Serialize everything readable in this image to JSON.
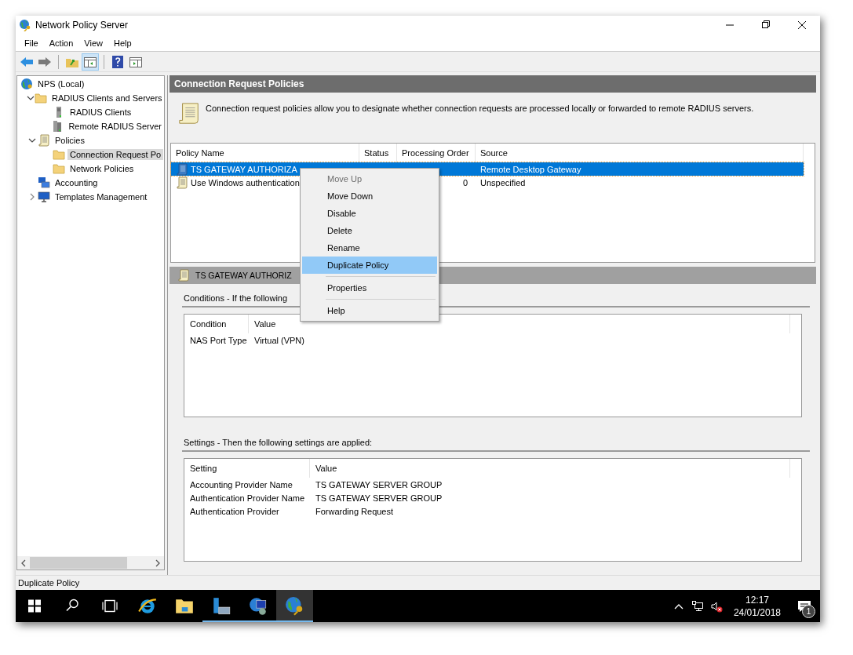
{
  "window": {
    "title": "Network Policy Server"
  },
  "menu": [
    "File",
    "Action",
    "View",
    "Help"
  ],
  "tree": [
    {
      "label": "NPS (Local)",
      "kind": "globe",
      "selected": false,
      "children": [
        {
          "label": "RADIUS Clients and Servers",
          "kind": "folder",
          "expanded": true,
          "selected": false,
          "children": [
            {
              "label": "RADIUS Clients",
              "kind": "server",
              "selected": false
            },
            {
              "label": "Remote RADIUS Server",
              "kind": "servers",
              "selected": false
            }
          ]
        },
        {
          "label": "Policies",
          "kind": "scroll",
          "expanded": true,
          "selected": false,
          "children": [
            {
              "label": "Connection Request Po",
              "kind": "folder",
              "selected": true
            },
            {
              "label": "Network Policies",
              "kind": "folder",
              "selected": false
            }
          ]
        },
        {
          "label": "Accounting",
          "kind": "computers",
          "selected": false
        },
        {
          "label": "Templates Management",
          "kind": "monitor",
          "expanded": false,
          "selected": false
        }
      ]
    }
  ],
  "pane": {
    "title": "Connection Request Policies",
    "description": "Connection request policies allow you to designate whether connection requests are processed locally or forwarded to remote RADIUS servers."
  },
  "policies": {
    "columns": [
      "Policy Name",
      "Status",
      "Processing Order",
      "Source"
    ],
    "rows": [
      {
        "name": "TS GATEWAY AUTHORIZA",
        "order": "",
        "source": "Remote Desktop Gateway",
        "kind": "blue",
        "selected": true
      },
      {
        "name": "Use Windows authentication",
        "order": "0",
        "source": "Unspecified",
        "kind": "scroll",
        "selected": false
      }
    ]
  },
  "detail": {
    "title": "TS GATEWAY AUTHORIZ",
    "conditions": {
      "label": "Conditions - If the following",
      "columns": [
        "Condition",
        "Value"
      ],
      "rows": [
        [
          "NAS Port Type",
          "Virtual (VPN)"
        ]
      ]
    },
    "settings": {
      "label": "Settings - Then the following settings are applied:",
      "columns": [
        "Setting",
        "Value"
      ],
      "rows": [
        [
          "Accounting Provider Name",
          "TS GATEWAY SERVER GROUP"
        ],
        [
          "Authentication Provider Name",
          "TS GATEWAY SERVER GROUP"
        ],
        [
          "Authentication Provider",
          "Forwarding Request"
        ]
      ]
    }
  },
  "context_menu": [
    {
      "kind": "item",
      "label": "Move Up",
      "disabled": true,
      "selected": false
    },
    {
      "kind": "item",
      "label": "Move Down",
      "disabled": false,
      "selected": false
    },
    {
      "kind": "item",
      "label": "Disable",
      "disabled": false,
      "selected": false
    },
    {
      "kind": "item",
      "label": "Delete",
      "disabled": false,
      "selected": false
    },
    {
      "kind": "item",
      "label": "Rename",
      "disabled": false,
      "selected": false
    },
    {
      "kind": "item",
      "label": "Duplicate Policy",
      "disabled": false,
      "selected": true
    },
    {
      "kind": "separator"
    },
    {
      "kind": "item",
      "label": "Properties",
      "disabled": false,
      "selected": false
    },
    {
      "kind": "separator"
    },
    {
      "kind": "item",
      "label": "Help",
      "disabled": false,
      "selected": false
    }
  ],
  "status_bar": "Duplicate Policy",
  "taskbar": {
    "apps": [
      {
        "kind": "ie",
        "running": false,
        "active": false
      },
      {
        "kind": "explorer",
        "running": false,
        "active": false
      },
      {
        "kind": "server-manager",
        "running": true,
        "active": false
      },
      {
        "kind": "remote",
        "running": true,
        "active": false
      },
      {
        "kind": "nps",
        "running": true,
        "active": true
      }
    ],
    "time": "12:17",
    "date": "24/01/2018",
    "notifications": "1"
  }
}
